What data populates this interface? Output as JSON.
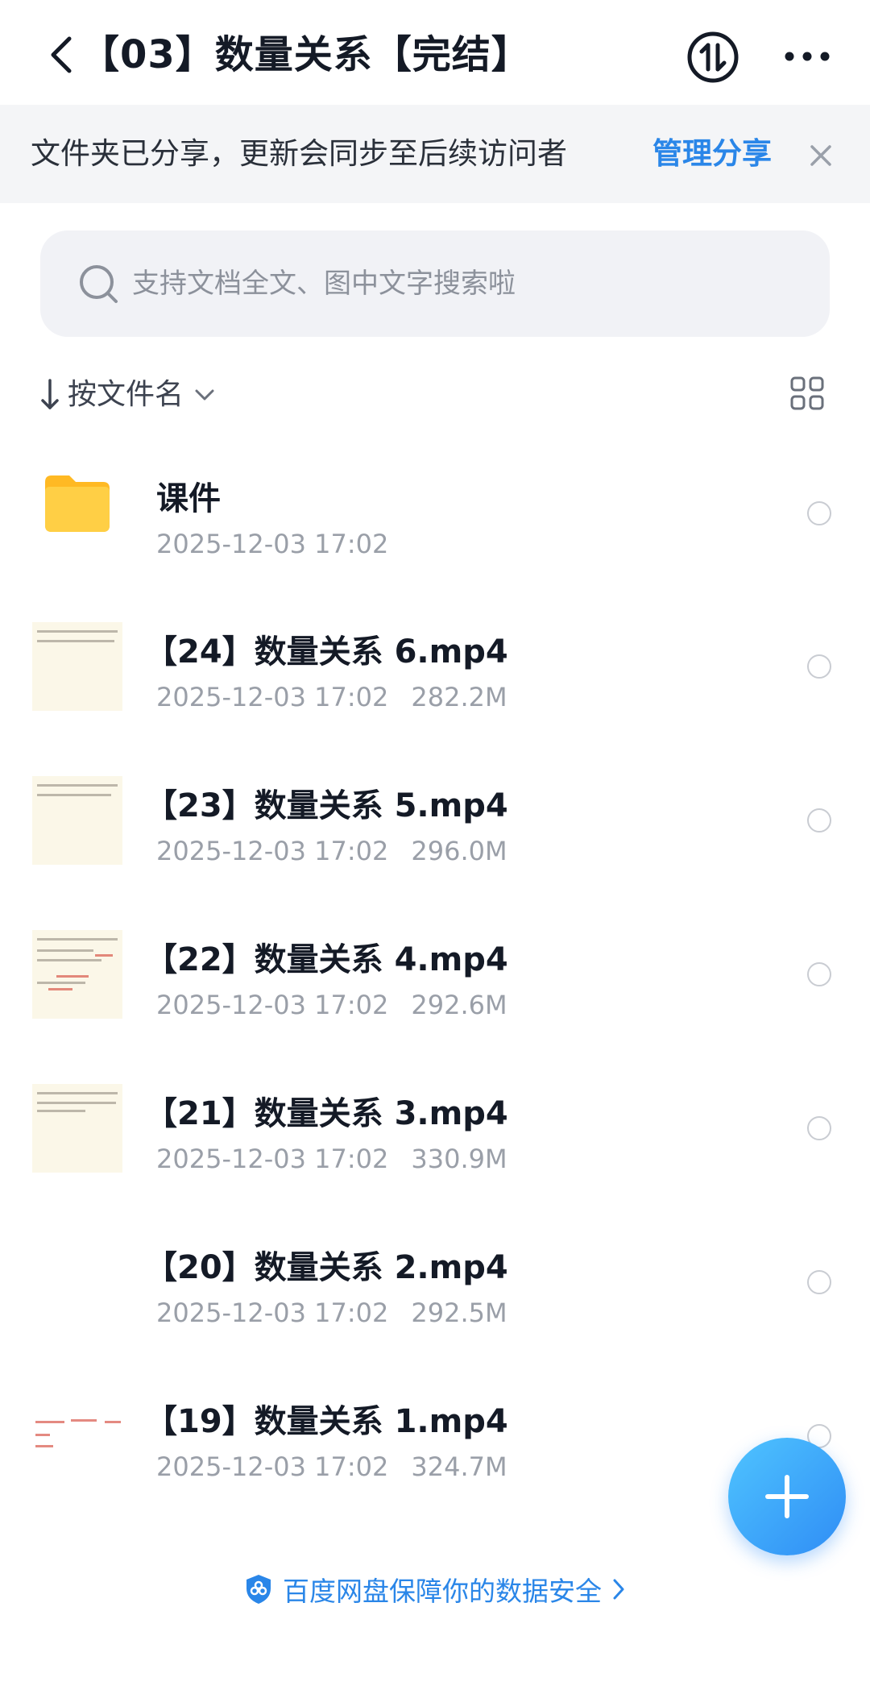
{
  "header": {
    "title": "【03】数量关系【完结】"
  },
  "share_banner": {
    "text": "文件夹已分享，更新会同步至后续访问者",
    "manage_label": "管理分享"
  },
  "search": {
    "placeholder": "支持文档全文、图中文字搜索啦"
  },
  "sort": {
    "label": "按文件名"
  },
  "files": [
    {
      "name": "课件",
      "date": "2025-12-03 17:02",
      "size": "",
      "type": "folder"
    },
    {
      "name": "【24】数量关系 6.mp4",
      "date": "2025-12-03 17:02",
      "size": "282.2M",
      "type": "video"
    },
    {
      "name": "【23】数量关系 5.mp4",
      "date": "2025-12-03 17:02",
      "size": "296.0M",
      "type": "video"
    },
    {
      "name": "【22】数量关系 4.mp4",
      "date": "2025-12-03 17:02",
      "size": "292.6M",
      "type": "video"
    },
    {
      "name": "【21】数量关系 3.mp4",
      "date": "2025-12-03 17:02",
      "size": "330.9M",
      "type": "video"
    },
    {
      "name": "【20】数量关系 2.mp4",
      "date": "2025-12-03 17:02",
      "size": "292.5M",
      "type": "video"
    },
    {
      "name": "【19】数量关系 1.mp4",
      "date": "2025-12-03 17:02",
      "size": "324.7M",
      "type": "video"
    }
  ],
  "footer": {
    "text": "百度网盘保障你的数据安全"
  },
  "colors": {
    "accent": "#2a86e8",
    "fab_start": "#4fc4ff",
    "fab_end": "#2f8df5",
    "folder": "#ffc83d"
  }
}
